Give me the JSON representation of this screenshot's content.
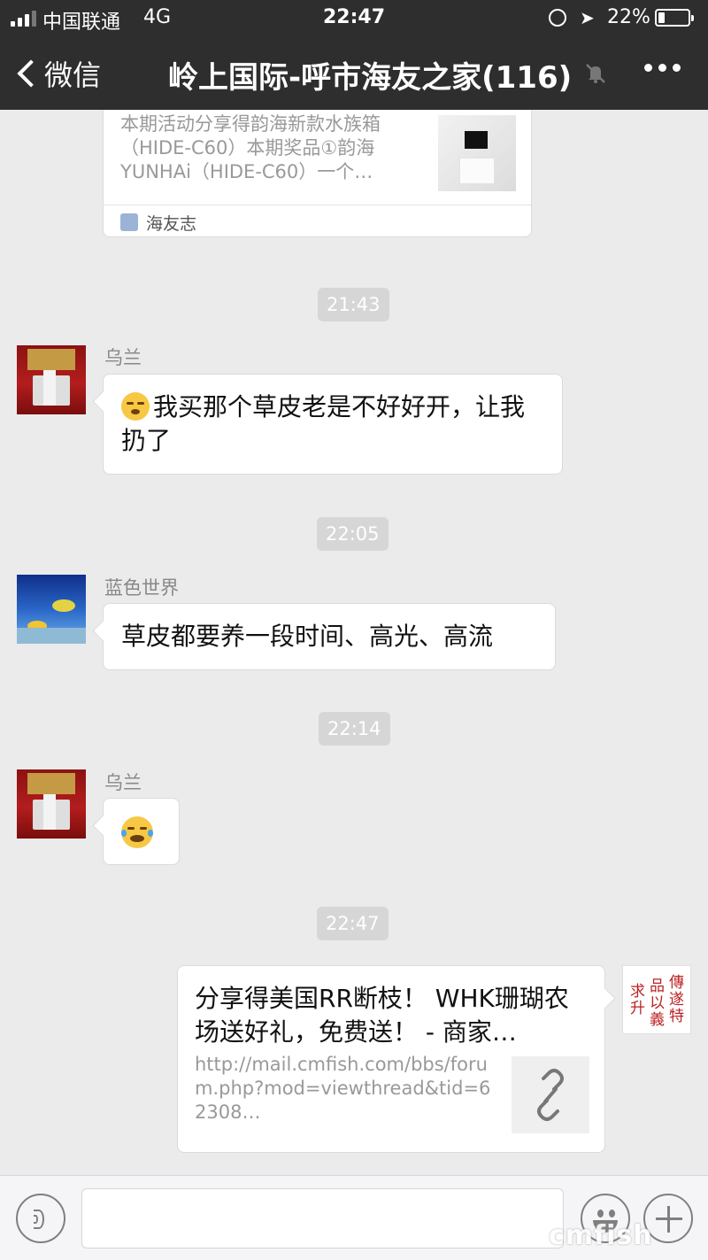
{
  "status_bar": {
    "carrier": "中国联通",
    "network": "4G",
    "time": "22:47",
    "battery": "22%",
    "battery_level": 0.22
  },
  "nav": {
    "back_label": "微信",
    "title": "岭上国际-呼市海友之家(116)",
    "icons": [
      "chevron-left-icon",
      "mute-bell-icon",
      "more-icon"
    ]
  },
  "messages": {
    "top_card": {
      "description": "本期活动分享得韵海新款水族箱（HIDE-C60）本期奖品①韵海YUNHAi（HIDE-C60）一个…",
      "source": "海友志"
    },
    "time_1": "21:43",
    "msg_1": {
      "sender": "乌兰",
      "text": "我买那个草皮老是不好好开，让我扔了"
    },
    "time_2": "22:05",
    "msg_2": {
      "sender": "蓝色世界",
      "text": "草皮都要养一段时间、高光、高流"
    },
    "time_3": "22:14",
    "msg_3": {
      "sender": "乌兰",
      "emoji": "crying-laughing-emoji"
    },
    "time_4": "22:47",
    "link_card": {
      "title": "分享得美国RR断枝！ WHK珊瑚农场送好礼，免费送！ - 商家…",
      "url": "http://mail.cmfish.com/bbs/forum.php?mod=viewthread&tid=62308…"
    }
  },
  "input_bar": {
    "icons": [
      "voice-icon",
      "emoji-icon",
      "plus-icon"
    ],
    "watermark": "cmfish"
  }
}
